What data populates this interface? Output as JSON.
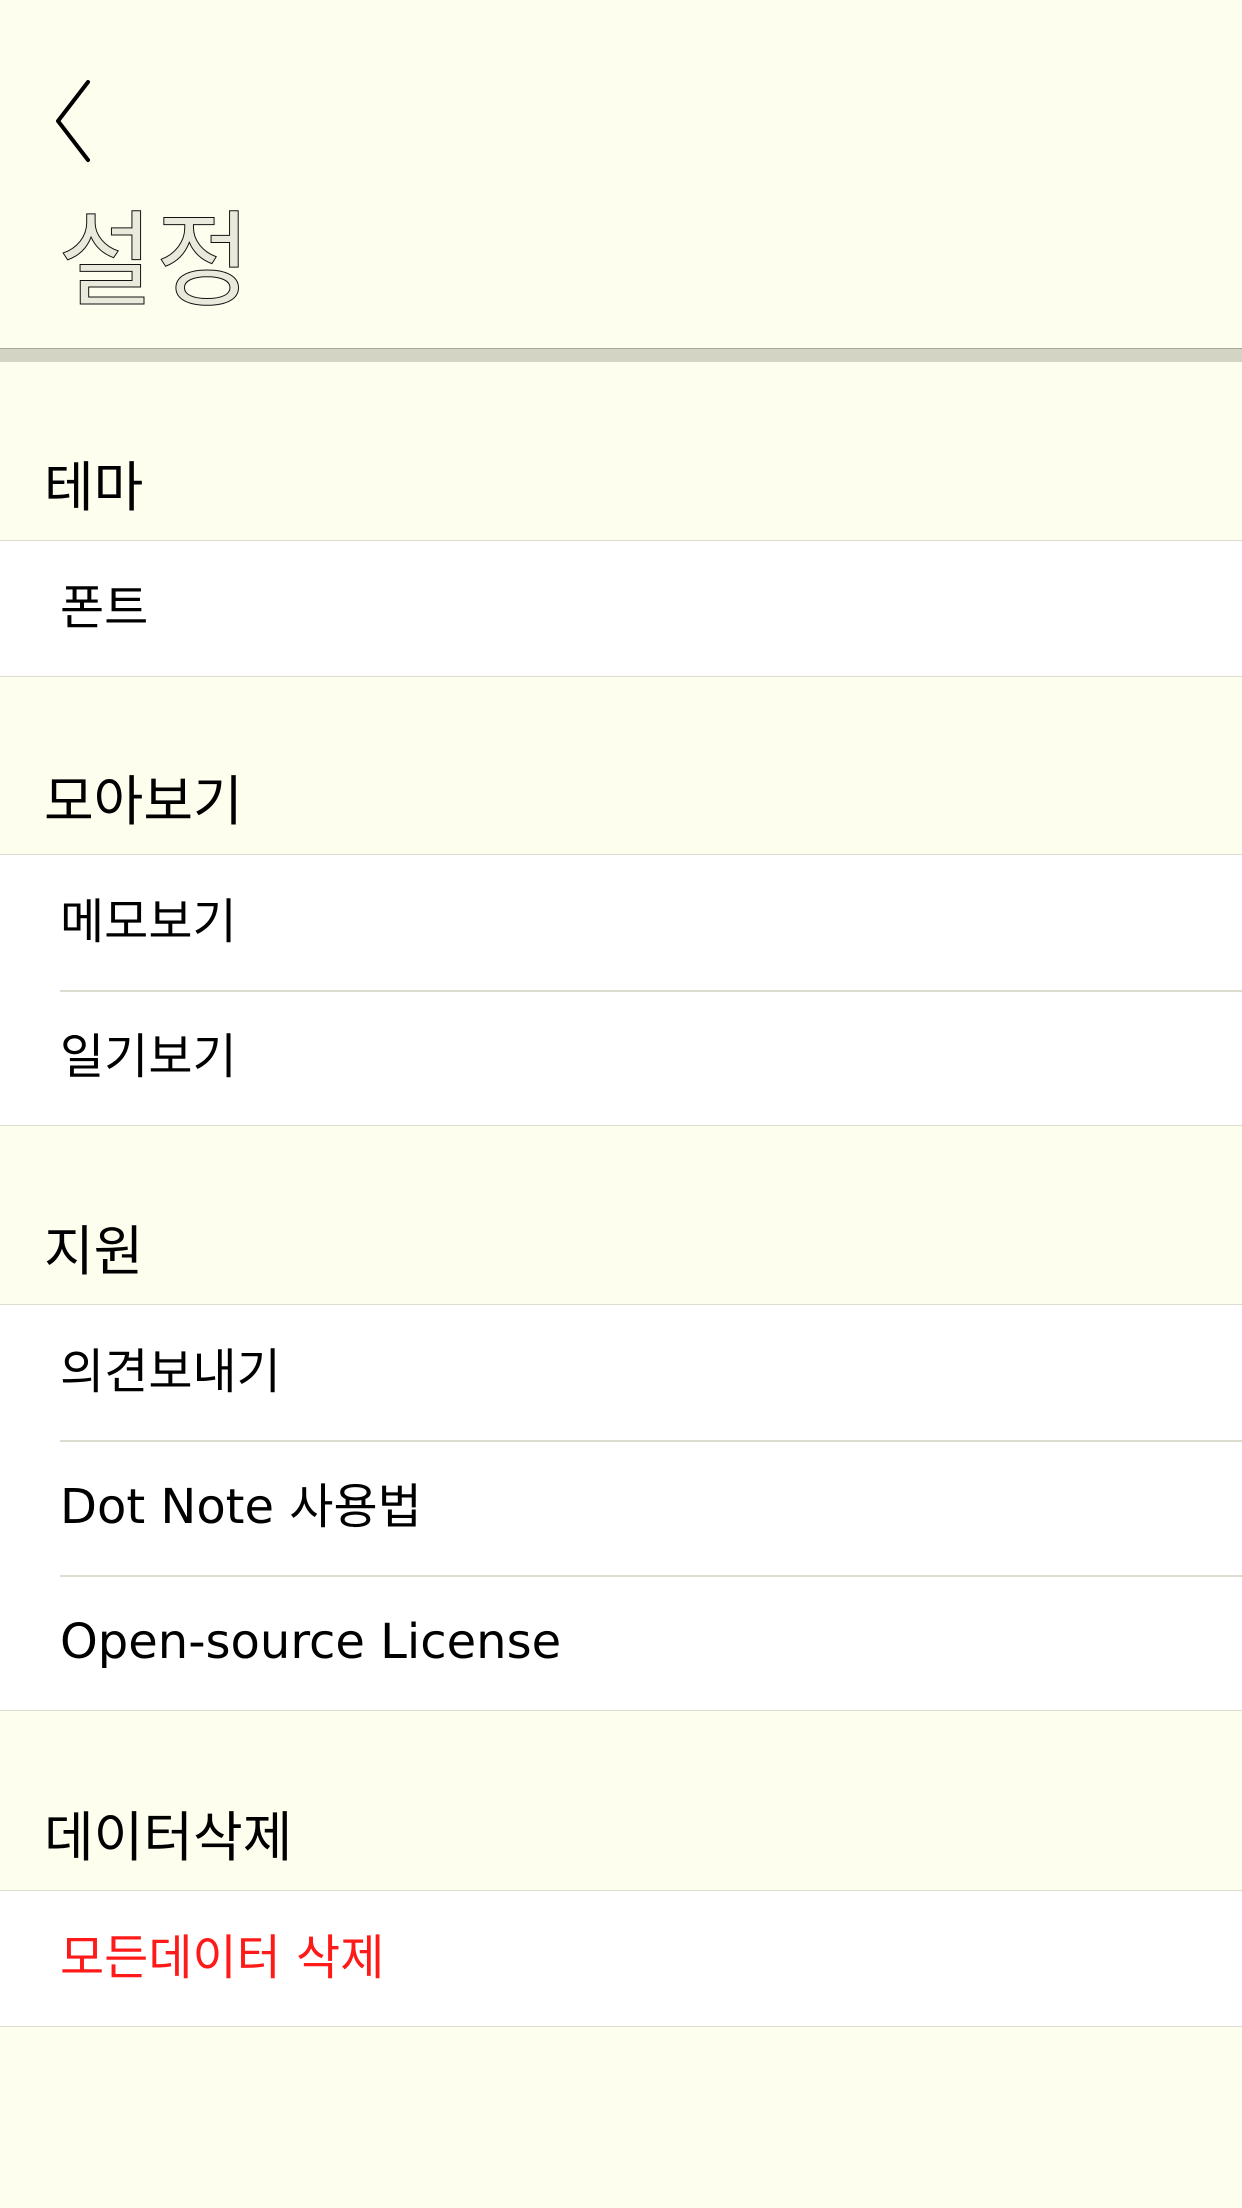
{
  "header": {
    "back_icon": "chevron-left-icon",
    "title": "설정"
  },
  "sections": [
    {
      "title": "테마",
      "items": [
        {
          "label": "폰트"
        }
      ]
    },
    {
      "title": "모아보기",
      "items": [
        {
          "label": "메모보기"
        },
        {
          "label": "일기보기"
        }
      ]
    },
    {
      "title": "지원",
      "items": [
        {
          "label": "의견보내기"
        },
        {
          "label": "Dot Note 사용법"
        },
        {
          "label": "Open-source License"
        }
      ]
    },
    {
      "title": "데이터삭제",
      "items": [
        {
          "label": "모든데이터 삭제",
          "color": "#ff1a1a"
        }
      ]
    }
  ],
  "colors": {
    "background": "#fefeef",
    "group_background": "#ffffff",
    "separator": "#dcdcd0",
    "danger": "#ff1a1a"
  }
}
